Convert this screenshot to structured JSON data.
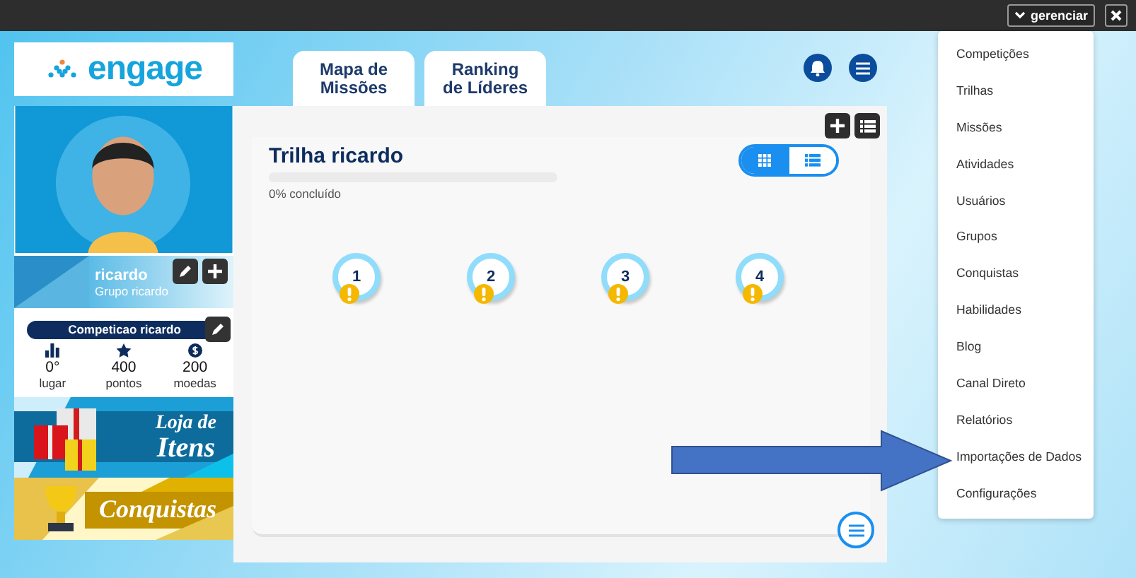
{
  "top_bar": {
    "manage_button": "gerenciar"
  },
  "logo": {
    "text": "engage"
  },
  "tabs": [
    {
      "label": "Mapa de\nMissões"
    },
    {
      "label": "Ranking\nde Líderes"
    }
  ],
  "profile": {
    "name": "ricardo",
    "group": "Grupo ricardo",
    "competition": "Competicao ricardo",
    "stats": [
      {
        "kind": "rank",
        "value": "0°",
        "label": "lugar"
      },
      {
        "kind": "points",
        "value": "400",
        "label": "pontos"
      },
      {
        "kind": "coins",
        "value": "200",
        "label": "moedas"
      }
    ]
  },
  "banners": [
    {
      "kind": "gifts",
      "lines": [
        "Loja de",
        "Itens"
      ]
    },
    {
      "kind": "trophy",
      "lines": [
        "Conquistas"
      ]
    }
  ],
  "trail": {
    "title": "Trilha ricardo",
    "level": 0,
    "progress_text": "0% concluído",
    "view_toggle": [
      {
        "kind": "grid",
        "selected": true
      },
      {
        "kind": "list",
        "selected": false
      }
    ],
    "nodes": [
      {
        "label": "1",
        "warning": true
      },
      {
        "label": "2",
        "warning": true
      },
      {
        "label": "3",
        "warning": true
      },
      {
        "label": "4",
        "warning": true
      }
    ]
  },
  "menu": {
    "items": [
      "Competições",
      "Trilhas",
      "Missões",
      "Atividades",
      "Usuários",
      "Grupos",
      "Conquistas",
      "Habilidades",
      "Blog",
      "Canal Direto",
      "Relatórios",
      "Importações de Dados",
      "Configurações"
    ]
  }
}
